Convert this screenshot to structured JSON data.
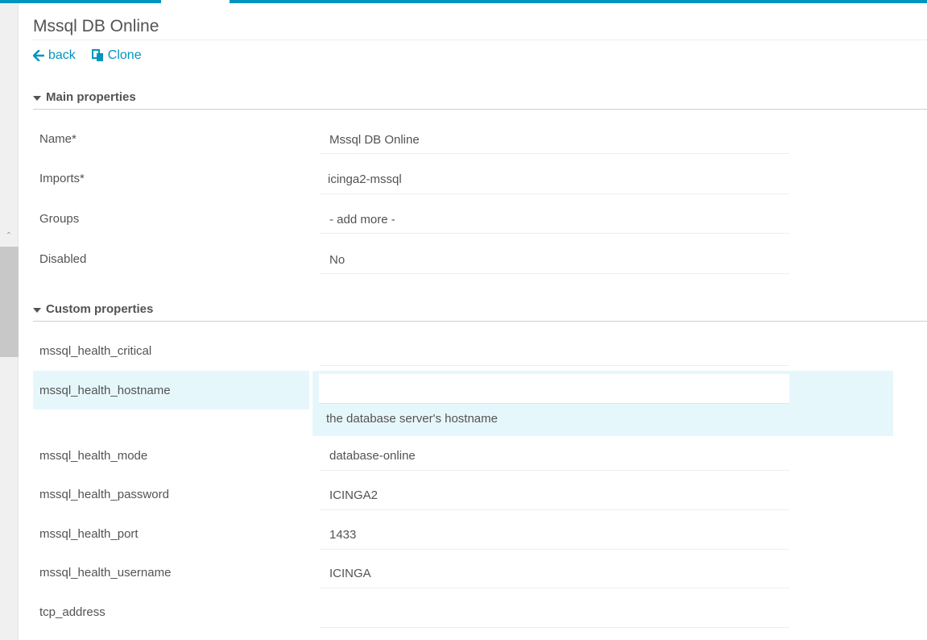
{
  "page": {
    "title": "Mssql DB Online"
  },
  "actions": {
    "back_label": "back",
    "clone_label": "Clone"
  },
  "sections": {
    "main_label": "Main properties",
    "custom_label": "Custom properties"
  },
  "main_properties": [
    {
      "label": "Name*",
      "value": "Mssql DB Online"
    },
    {
      "label": "Imports*",
      "value": "icinga2-mssql"
    },
    {
      "label": "Groups",
      "value": "- add more -"
    },
    {
      "label": "Disabled",
      "value": "No"
    }
  ],
  "custom_properties": [
    {
      "label": "mssql_health_critical",
      "value": ""
    },
    {
      "label": "mssql_health_hostname",
      "value": "",
      "description": "the database server's hostname"
    },
    {
      "label": "mssql_health_mode",
      "value": "database-online"
    },
    {
      "label": "mssql_health_password",
      "value": "ICINGA2"
    },
    {
      "label": "mssql_health_port",
      "value": "1433"
    },
    {
      "label": "mssql_health_username",
      "value": "ICINGA"
    },
    {
      "label": "tcp_address",
      "value": ""
    }
  ],
  "colors": {
    "accent": "#0095bf",
    "highlight": "#e6f7fc",
    "text": "#535353"
  }
}
